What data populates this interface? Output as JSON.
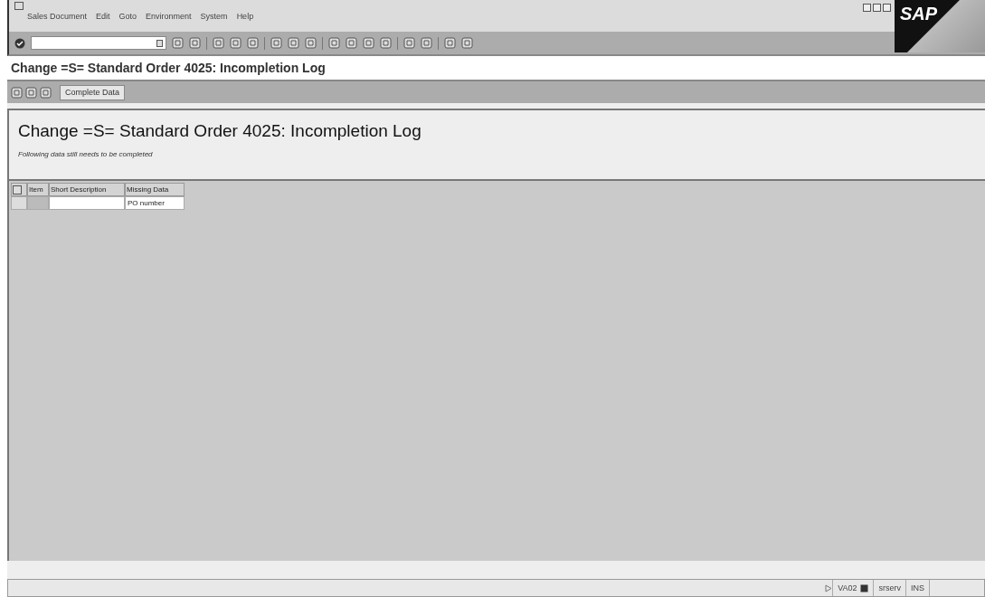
{
  "menu": [
    "Sales Document",
    "Edit",
    "Goto",
    "Environment",
    "System",
    "Help"
  ],
  "logo": "SAP",
  "title": "Change =S= Standard Order 4025: Incompletion Log",
  "app_toolbar": {
    "button": "Complete Data"
  },
  "header": {
    "title": "Change =S= Standard Order 4025: Incompletion Log",
    "subtitle": "Following data still needs to be completed"
  },
  "table": {
    "columns": [
      "Item",
      "Short Description",
      "Missing Data"
    ],
    "rows": [
      {
        "missing_data": "PO number"
      }
    ]
  },
  "status_bar": {
    "transaction": "VA02",
    "server": "srserv",
    "mode": "INS"
  }
}
